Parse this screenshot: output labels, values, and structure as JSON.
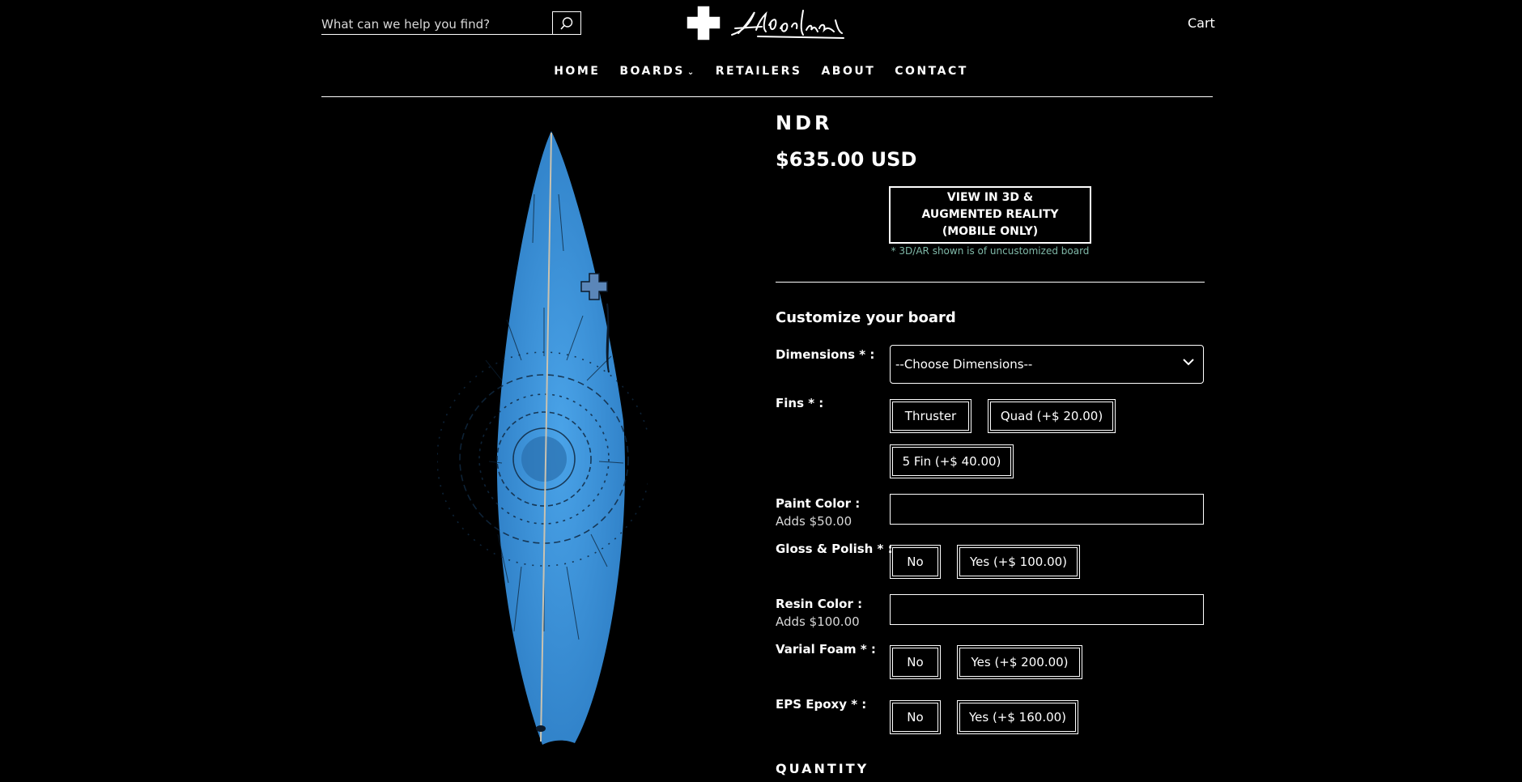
{
  "header": {
    "search_placeholder": "What can we help you find?",
    "search_icon": "search-icon",
    "logo_icon": "brand-cross-signature-logo",
    "cart_label": "Cart"
  },
  "nav": {
    "items": [
      {
        "label": "HOME"
      },
      {
        "label": "BOARDS"
      },
      {
        "label": "RETAILERS"
      },
      {
        "label": "ABOUT"
      },
      {
        "label": "CONTACT"
      }
    ]
  },
  "product": {
    "title": "NDR",
    "price": "$635.00 USD",
    "ar_button_label": "VIEW IN 3D & AUGMENTED REALITY (MOBILE ONLY)",
    "ar_note": "* 3D/AR shown is of uncustomized board",
    "image_alt_icon": "surfboard-image",
    "board_color": "#3a8fd6"
  },
  "customize": {
    "heading": "Customize your board",
    "dimensions": {
      "label": "Dimensions * :",
      "selected": "--Choose Dimensions--"
    },
    "fins": {
      "label": "Fins * :",
      "options": [
        "Thruster",
        "Quad (+$ 20.00)",
        "5 Fin (+$ 40.00)"
      ]
    },
    "paint_color": {
      "label": "Paint Color :",
      "sub": "Adds $50.00",
      "value": ""
    },
    "gloss_polish": {
      "label": "Gloss & Polish * :",
      "options": [
        "No",
        "Yes (+$ 100.00)"
      ]
    },
    "resin_color": {
      "label": "Resin Color :",
      "sub": "Adds $100.00",
      "value": ""
    },
    "varial_foam": {
      "label": "Varial Foam * :",
      "options": [
        "No",
        "Yes (+$ 200.00)"
      ]
    },
    "eps_epoxy": {
      "label": "EPS Epoxy * :",
      "options": [
        "No",
        "Yes (+$ 160.00)"
      ]
    },
    "quantity_label": "QUANTITY"
  }
}
